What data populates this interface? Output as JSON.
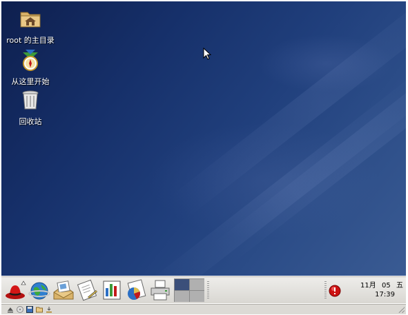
{
  "desktop": {
    "icons": [
      {
        "label": "root 的主目录",
        "icon": "home-folder-icon"
      },
      {
        "label": "从这里开始",
        "icon": "start-here-icon"
      },
      {
        "label": "回收站",
        "icon": "trash-icon"
      }
    ]
  },
  "panel": {
    "launchers": [
      {
        "name": "redhat-menu-icon"
      },
      {
        "name": "web-browser-icon"
      },
      {
        "name": "email-icon"
      },
      {
        "name": "writer-icon"
      },
      {
        "name": "impress-icon"
      },
      {
        "name": "calc-icon"
      },
      {
        "name": "print-manager-icon"
      }
    ],
    "workspaces": 4,
    "active_workspace": 1,
    "clock": {
      "month": "11月",
      "day": "05",
      "weekday": "五",
      "time": "17:39"
    }
  },
  "colors": {
    "desktop_dark": "#0e1f4e",
    "desktop_light": "#3a5b93",
    "panel": "#e6e5e1",
    "alert_red": "#cc1111"
  }
}
